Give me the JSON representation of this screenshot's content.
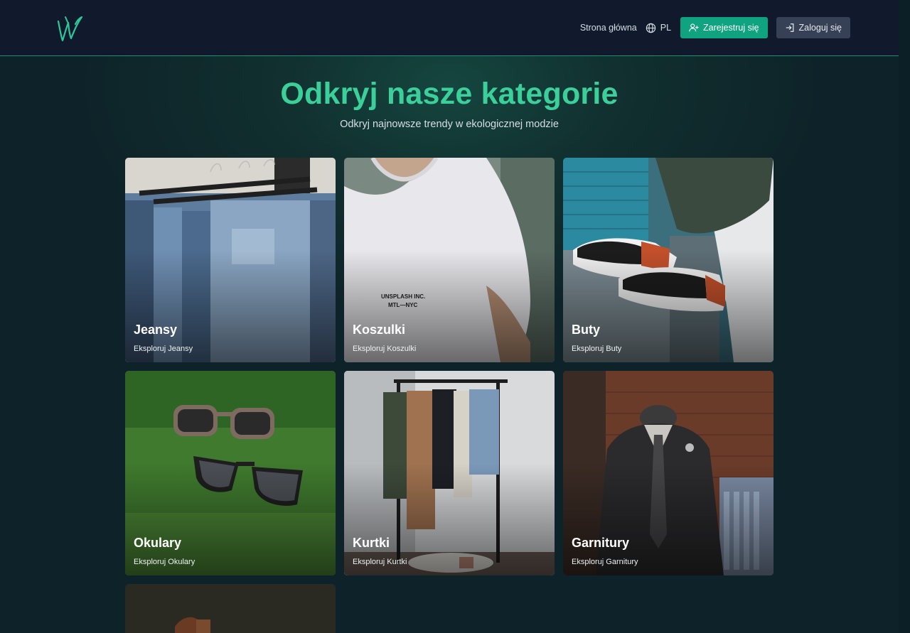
{
  "header": {
    "home_label": "Strona główna",
    "lang_label": "PL",
    "register_label": "Zarejestruj się",
    "login_label": "Zaloguj się"
  },
  "hero": {
    "title": "Odkryj nasze kategorie",
    "subtitle": "Odkryj najnowsze trendy w ekologicznej modzie"
  },
  "categories": [
    {
      "title": "Jeansy",
      "subtitle": "Eksploruj Jeansy"
    },
    {
      "title": "Koszulki",
      "subtitle": "Eksploruj Koszulki"
    },
    {
      "title": "Buty",
      "subtitle": "Eksploruj Buty"
    },
    {
      "title": "Okulary",
      "subtitle": "Eksploruj Okulary"
    },
    {
      "title": "Kurtki",
      "subtitle": "Eksploruj Kurtki"
    },
    {
      "title": "Garnitury",
      "subtitle": "Eksploruj Garnitury"
    }
  ],
  "colors": {
    "accent": "#10a37f",
    "title_green": "#3bcf9a",
    "header_bg": "#111a2c",
    "login_bg": "#374155"
  }
}
